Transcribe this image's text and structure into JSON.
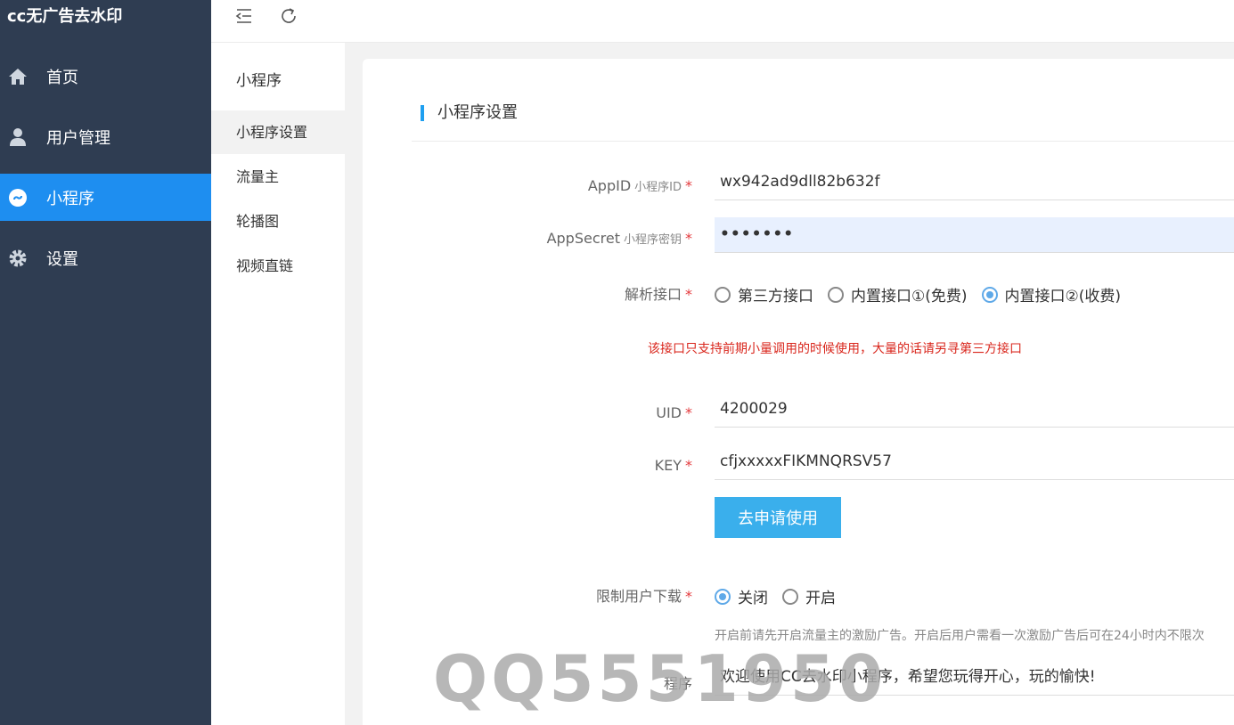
{
  "sidebar": {
    "brand": "cc无广告去水印",
    "items": [
      {
        "label": "首页",
        "icon": "home-icon"
      },
      {
        "label": "用户管理",
        "icon": "user-icon"
      },
      {
        "label": "小程序",
        "icon": "miniprogram-icon"
      },
      {
        "label": "设置",
        "icon": "gear-icon"
      }
    ]
  },
  "topbar": {
    "icons": [
      "menu-collapse-icon",
      "refresh-icon"
    ]
  },
  "subnav": {
    "title": "小程序",
    "items": [
      {
        "label": "小程序设置"
      },
      {
        "label": "流量主"
      },
      {
        "label": "轮播图"
      },
      {
        "label": "视频直链"
      }
    ]
  },
  "form": {
    "section_title": "小程序设置",
    "appid": {
      "label": "AppID",
      "sub": "小程序ID",
      "req": "*",
      "value": "wx942ad9dll82b632f"
    },
    "appsecret": {
      "label": "AppSecret",
      "sub": "小程序密钥",
      "req": "*",
      "value": "•••••••"
    },
    "api": {
      "label": "解析接口",
      "req": "*",
      "options": [
        "第三方接口",
        "内置接口①(免费)",
        "内置接口②(收费)"
      ],
      "selected": 2
    },
    "warning": "该接口只支持前期小量调用的时候使用，大量的话请另寻第三方接口",
    "uid": {
      "label": "UID",
      "req": "*",
      "value": "4200029"
    },
    "key": {
      "label": "KEY",
      "req": "*",
      "value": "cfjxxxxxFIKMNQRSV57"
    },
    "apply_button": "去申请使用",
    "limit": {
      "label": "限制用户下载",
      "req": "*",
      "options": [
        "关闭",
        "开启"
      ],
      "selected": 0
    },
    "limit_hint": "开启前请先开启流量主的激励广告。开启后用户需看一次激励广告后可在24小时内不限次",
    "welcome": {
      "label": "程序",
      "value": "欢迎使用CC去水印小程序，希望您玩得开心，玩的愉快!"
    }
  },
  "watermark": "QQ5551950",
  "colors": {
    "sidebar_bg": "#2f3d52",
    "active_blue": "#1e8ef0",
    "button_blue": "#3aafec",
    "warning_red": "#d9261c"
  }
}
